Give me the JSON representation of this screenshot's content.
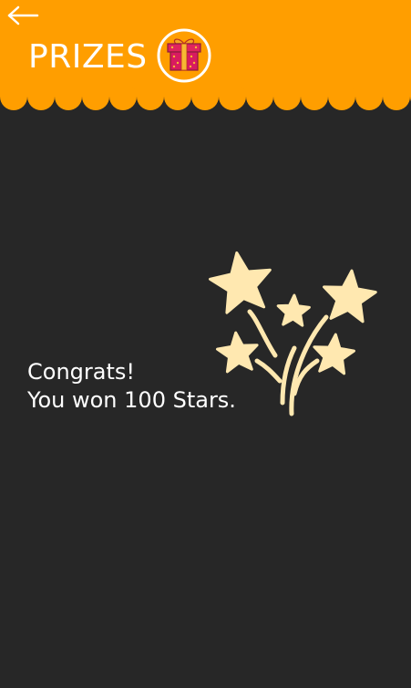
{
  "header": {
    "title": "PRIZES",
    "background_color": "#ff9e00",
    "back_icon": "arrow-left-icon",
    "badge_icon": "gift-icon"
  },
  "message": {
    "line1": "Congrats!",
    "line2": "You won 100 Stars."
  },
  "illustration": {
    "icon": "star-fireworks-icon",
    "color": "#ffe8b0"
  },
  "colors": {
    "background": "#272727",
    "text": "#ffffff"
  }
}
